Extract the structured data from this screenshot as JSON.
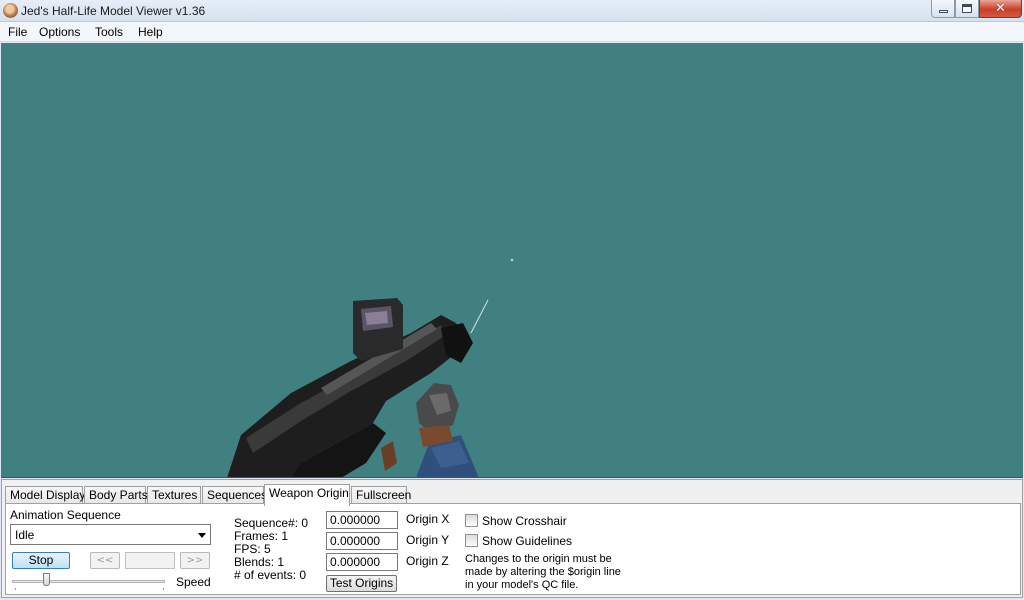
{
  "window": {
    "title": "Jed's Half-Life Model Viewer v1.36",
    "close_glyph": "✕"
  },
  "menu": [
    "File",
    "Options",
    "Tools",
    "Help"
  ],
  "viewport": {
    "background": "#418080"
  },
  "tabs": [
    "Model Display",
    "Body Parts",
    "Textures",
    "Sequences",
    "Weapon Origin",
    "Fullscreen"
  ],
  "active_tab": "Weapon Origin",
  "animation": {
    "label": "Animation Sequence",
    "selected": "Idle",
    "stop_label": "Stop",
    "prev_label": "<<",
    "next_label": ">>",
    "speed_label": "Speed"
  },
  "sequence_info": {
    "sequence": "Sequence#: 0",
    "frames": "Frames: 1",
    "fps": "FPS: 5",
    "blends": "Blends: 1",
    "events": "# of events: 0"
  },
  "origin": {
    "x_value": "0.000000",
    "y_value": "0.000000",
    "z_value": "0.000000",
    "x_label": "Origin X",
    "y_label": "Origin Y",
    "z_label": "Origin Z",
    "test_label": "Test Origins"
  },
  "options": {
    "show_crosshair": "Show Crosshair",
    "show_guidelines": "Show Guidelines",
    "crosshair_checked": false,
    "guidelines_checked": false
  },
  "note": [
    "Changes to the origin must be",
    "made by altering the $origin line",
    "in your model's QC file."
  ]
}
